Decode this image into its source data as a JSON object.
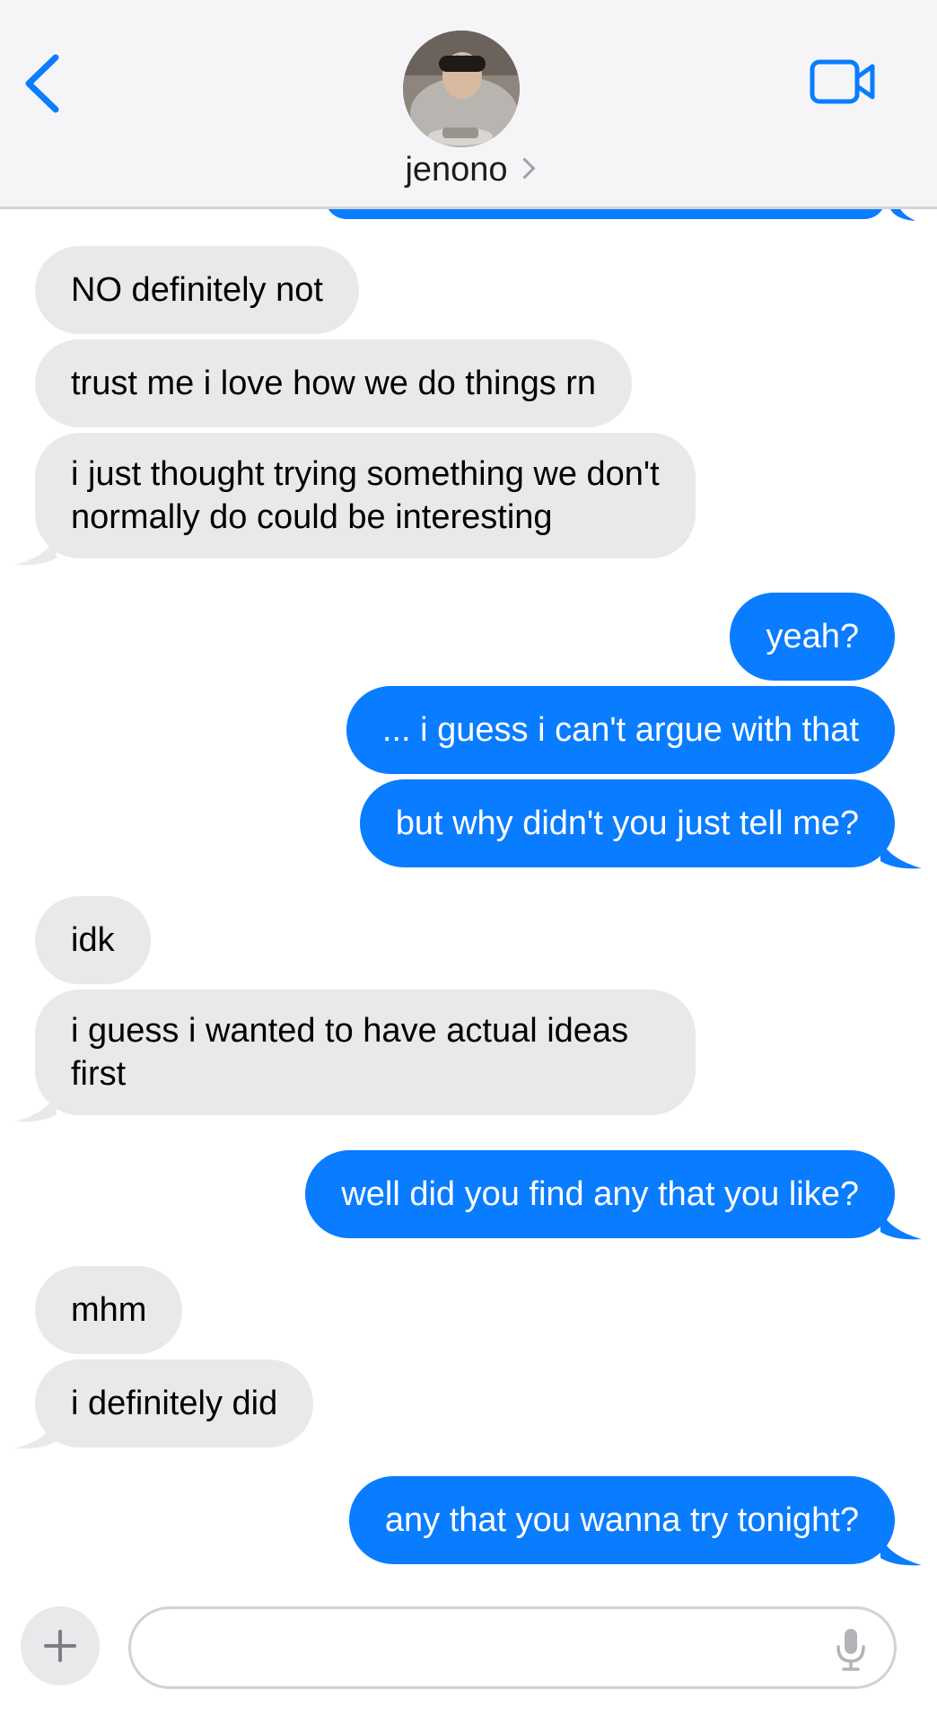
{
  "header": {
    "contact_name": "jenono"
  },
  "messages": [
    {
      "direction": "incoming",
      "text": "NO definitely not"
    },
    {
      "direction": "incoming",
      "text": "trust me i love how we do things rn"
    },
    {
      "direction": "incoming",
      "text": "i just thought trying something we don't normally do could be interesting"
    },
    {
      "direction": "outgoing",
      "text": "yeah?"
    },
    {
      "direction": "outgoing",
      "text": "... i guess i can't argue with that"
    },
    {
      "direction": "outgoing",
      "text": "but why didn't you just tell me?"
    },
    {
      "direction": "incoming",
      "text": "idk"
    },
    {
      "direction": "incoming",
      "text": "i guess i wanted to have actual ideas first"
    },
    {
      "direction": "outgoing",
      "text": "well did you find any that you like?"
    },
    {
      "direction": "incoming",
      "text": "mhm"
    },
    {
      "direction": "incoming",
      "text": "i definitely did"
    },
    {
      "direction": "outgoing",
      "text": "any that you wanna try tonight?"
    }
  ],
  "input": {
    "value": "",
    "placeholder": ""
  },
  "colors": {
    "outgoing_bubble": "#0a7cff",
    "incoming_bubble": "#e9e9eb",
    "accent": "#0a7cff",
    "header_bg": "#f5f5f7"
  },
  "icons": {
    "back": "chevron-left-icon",
    "video": "video-camera-icon",
    "add": "plus-icon",
    "mic": "microphone-icon"
  }
}
